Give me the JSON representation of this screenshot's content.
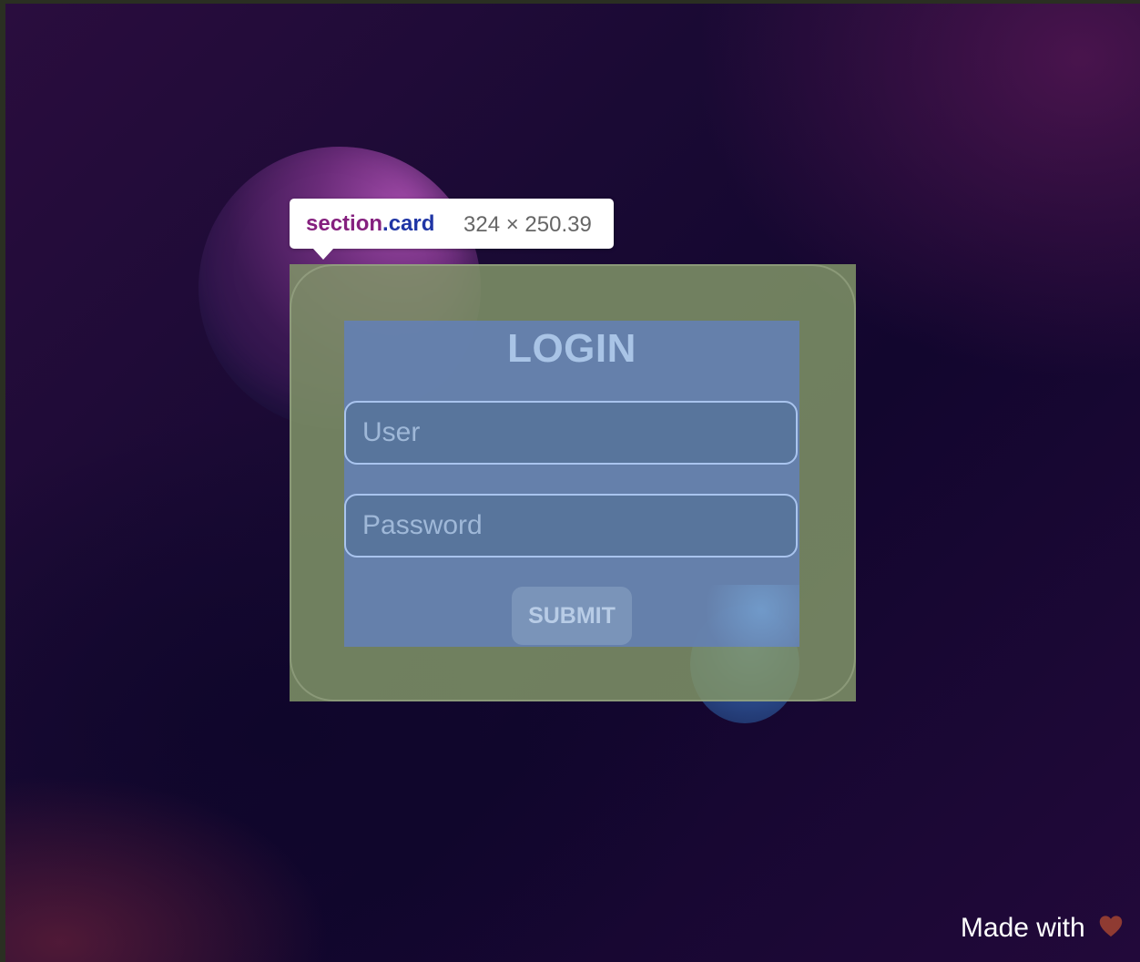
{
  "tooltip": {
    "tag": "section",
    "class_name": ".card",
    "dimensions": "324 × 250.39"
  },
  "login": {
    "title": "LOGIN",
    "user_placeholder": "User",
    "password_placeholder": "Password",
    "submit_label": "SUBMIT"
  },
  "footer": {
    "text": "Made with",
    "icon": "heart-icon",
    "icon_color": "#8f3b32"
  },
  "colors": {
    "card_highlight": "#7f946a",
    "content_highlight": "#6480b2",
    "tooltip_tag": "#85207e",
    "tooltip_class": "#1f35a5"
  }
}
